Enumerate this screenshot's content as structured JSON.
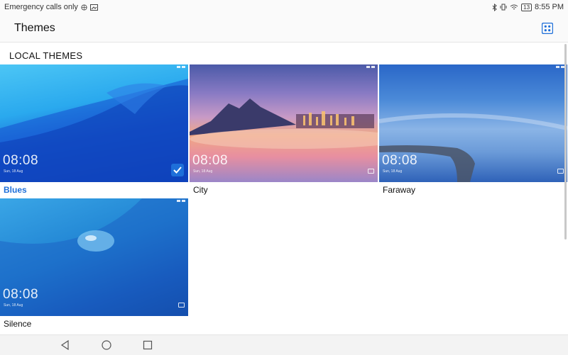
{
  "status": {
    "left_text": "Emergency calls only",
    "battery": "13",
    "time": "8:55 PM"
  },
  "header": {
    "title": "Themes"
  },
  "section": {
    "title": "LOCAL THEMES"
  },
  "themes": [
    {
      "name": "Blues",
      "clock": "08:08",
      "date": "Sun, 18 Aug",
      "selected": true
    },
    {
      "name": "City",
      "clock": "08:08",
      "date": "Sun, 18 Aug",
      "selected": false
    },
    {
      "name": "Faraway",
      "clock": "08:08",
      "date": "Sun, 18 Aug",
      "selected": false
    },
    {
      "name": "Silence",
      "clock": "08:08",
      "date": "Sun, 18 Aug",
      "selected": false
    }
  ],
  "colors": {
    "accent": "#1e6fd9"
  },
  "icons": {
    "header_action": "grid-layout-icon",
    "nav": [
      "back-icon",
      "home-icon",
      "recents-icon"
    ]
  }
}
